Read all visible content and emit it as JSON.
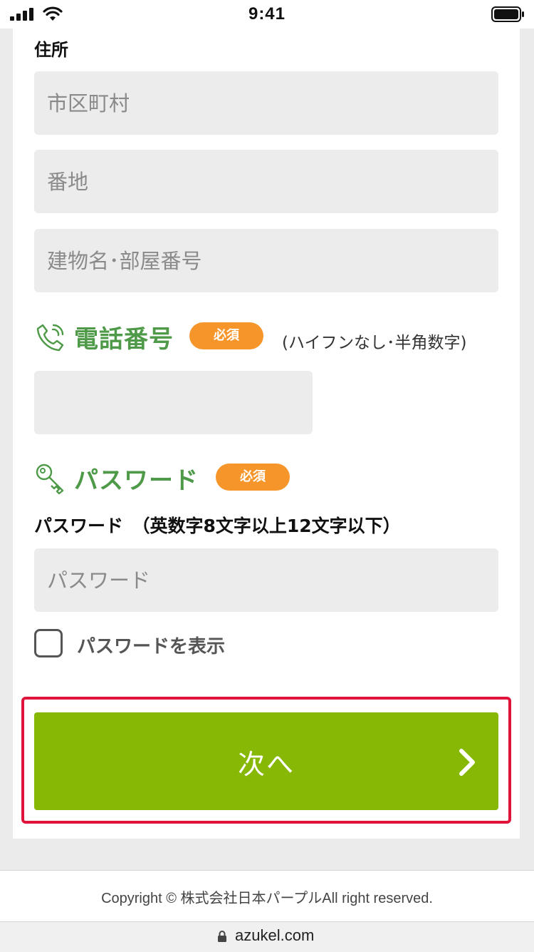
{
  "status_bar": {
    "time": "9:41"
  },
  "address": {
    "label": "住所",
    "city_placeholder": "市区町村",
    "street_placeholder": "番地",
    "building_placeholder": "建物名･部屋番号"
  },
  "phone": {
    "title": "電話番号",
    "required_badge": "必須",
    "hint": "(ハイフンなし･半角数字)",
    "value": ""
  },
  "password": {
    "title": "パスワード",
    "required_badge": "必須",
    "field_label": "パスワード　（英数字8文字以上12文字以下）",
    "placeholder": "パスワード",
    "show_label": "パスワードを表示",
    "show_checked": false
  },
  "next_button": {
    "label": "次へ"
  },
  "footer": {
    "copyright": "Copyright © 株式会社日本パープルAll right reserved."
  },
  "browser": {
    "url": "azukel.com"
  },
  "colors": {
    "accent_green": "#4e9a48",
    "button_green": "#86b805",
    "badge_orange": "#f6962a",
    "highlight_red": "#e0143a"
  },
  "icons": {
    "phone": "phone-icon",
    "password": "key-icon",
    "next": "chevron-right-icon",
    "lock": "lock-icon"
  }
}
